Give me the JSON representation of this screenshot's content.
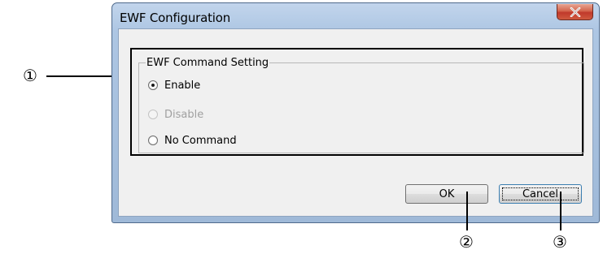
{
  "window": {
    "title": "EWF Configuration",
    "close_icon": "close-x-icon"
  },
  "group": {
    "label": "EWF Command Setting",
    "options": [
      {
        "label": "Enable",
        "checked": true,
        "enabled": true
      },
      {
        "label": "Disable",
        "checked": false,
        "enabled": false
      },
      {
        "label": "No Command",
        "checked": false,
        "enabled": true
      }
    ]
  },
  "buttons": {
    "ok": "OK",
    "cancel": "Cancel"
  },
  "callouts": {
    "one": "①",
    "two": "②",
    "three": "③"
  },
  "colors": {
    "close_button": "#c0392b",
    "frame": "#adc6e3",
    "client": "#f0f0f0"
  }
}
